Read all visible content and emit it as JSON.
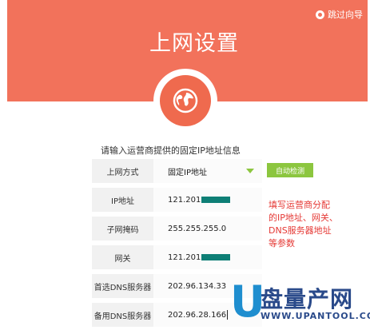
{
  "header": {
    "skip_label": "跳过向导",
    "title": "上网设置",
    "bg_color": "#f2725b"
  },
  "globe_icon": "globe-icon",
  "hint": "请输入运营商提供的固定IP地址信息",
  "form": {
    "rows": [
      {
        "label": "上网方式",
        "value": "固定IP地址"
      },
      {
        "label": "IP地址",
        "value": "121.201"
      },
      {
        "label": "子网掩码",
        "value": "255.255.255.0"
      },
      {
        "label": "网关",
        "value": "121.201"
      },
      {
        "label": "首选DNS服务器",
        "value": "202.96.134.33"
      },
      {
        "label": "备用DNS服务器",
        "value": "202.96.28.166"
      }
    ],
    "auto_detect_label": "自动检测",
    "accent_color": "#8cc63f",
    "mask_color": "#0e7f76"
  },
  "annotation": {
    "line1": "填写运营商分配",
    "line2": "的IP地址、网关、",
    "line3": "DNS服务器地址",
    "line4": "等参数",
    "color": "#e53935"
  },
  "watermark": {
    "u": "U",
    "text": "盘量产网",
    "url": "WWW.UPANTOOL.COM"
  }
}
